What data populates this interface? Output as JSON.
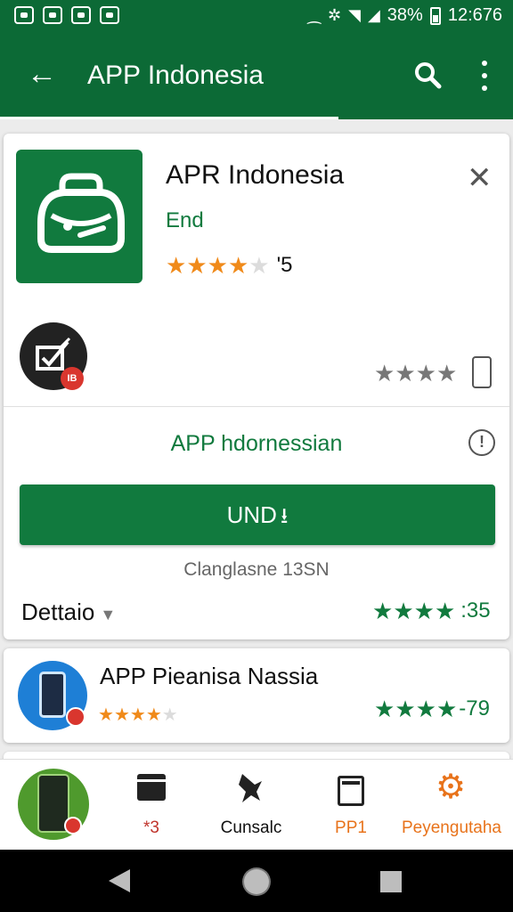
{
  "status_bar": {
    "battery": "38%",
    "time": "12:676",
    "colors": {
      "background": "#0c6a36"
    }
  },
  "app_bar": {
    "title": "APP Indonesia",
    "back_icon": "arrow-left-icon",
    "search_icon": "search-icon",
    "more_icon": "more-vert-icon"
  },
  "app_card": {
    "title": "APR Indonesia",
    "subtitle": "End",
    "rating_display": "'5",
    "rating_stars": 4,
    "secondary_rating_stars": 4,
    "badge_text": "IB",
    "app_name": "APP hdornessian",
    "install_label": "UND",
    "caption": "Clanglasne 13SN",
    "details_label": "Dettaio",
    "details_rating_text": ":35",
    "details_rating_stars": 4,
    "colors": {
      "brand_green": "#117a3e",
      "star_orange": "#f08a1a"
    }
  },
  "related_app": {
    "title": "APP Pieanisa Nassia",
    "rating_stars": 4,
    "rating_text": "-79"
  },
  "bottom_nav": {
    "items": [
      {
        "label": "",
        "icon": "phone-app-icon"
      },
      {
        "label": "*3",
        "icon": "clapperboard-icon",
        "color": "#c0342c"
      },
      {
        "label": "Cunsalc",
        "icon": "pin-icon",
        "color": "#111111"
      },
      {
        "label": "PP1",
        "icon": "tablet-icon",
        "color": "#e8731b"
      },
      {
        "label": "Peyengutaha",
        "icon": "gear-icon",
        "color": "#e8731b"
      }
    ]
  },
  "system_nav": {
    "icons": [
      "back-triangle-icon",
      "home-circle-icon",
      "recents-square-icon"
    ]
  }
}
